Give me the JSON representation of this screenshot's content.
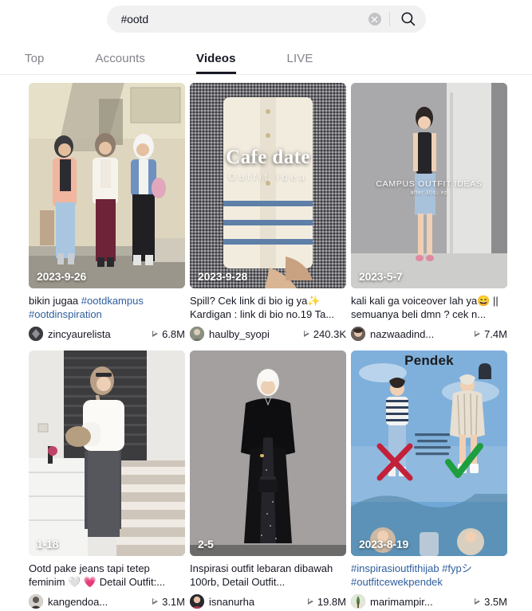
{
  "search": {
    "value": "#ootd",
    "placeholder": "Search",
    "clear_icon": "close-circle-icon",
    "search_icon": "search-icon"
  },
  "tabs": [
    {
      "label": "Top",
      "active": false
    },
    {
      "label": "Accounts",
      "active": false
    },
    {
      "label": "Videos",
      "active": true
    },
    {
      "label": "LIVE",
      "active": false
    }
  ],
  "colors": {
    "text": "#161823",
    "muted": "#82838c",
    "link": "#2f5e9e",
    "field_bg": "#f1f1f2"
  },
  "videos": [
    {
      "date": "2023-9-26",
      "caption_parts": [
        {
          "text": "bikin jugaa ",
          "tag": false
        },
        {
          "text": "#ootdkampus",
          "tag": true
        },
        {
          "text": " ",
          "tag": false
        },
        {
          "text": "#ootdinspiration",
          "tag": true
        }
      ],
      "caption_plain": "bikin jugaa #ootdkampus #ootdinspiration",
      "author": "zincyaurelista",
      "likes": "6.8M",
      "overlay": "",
      "overlay_sub": "",
      "scene": "campus-group"
    },
    {
      "date": "2023-9-28",
      "caption_parts": [
        {
          "text": "Spill? Cek link di bio ig ya✨ Kardigan : link di bio no.19 Ta...",
          "tag": false
        }
      ],
      "caption_plain": "Spill? Cek link di bio ig ya✨ Kardigan : link di bio no.19 Ta...",
      "author": "haulby_syopi",
      "likes": "240.3K",
      "overlay": "Cafe date",
      "overlay_sub": "Outfit Idea",
      "scene": "cardigan-flatlay"
    },
    {
      "date": "2023-5-7",
      "caption_parts": [
        {
          "text": "kali kali ga voiceover lah ya😄 || semuanya beli dmn ? cek n...",
          "tag": false
        }
      ],
      "caption_plain": "kali kali ga voiceover lah ya😄 || semuanya beli dmn ? cek n...",
      "author": "nazwaadind...",
      "likes": "7.4M",
      "overlay": "CAMPUS OUTFIT IDEAS",
      "overlay_sub": "after 30s↓ ep",
      "scene": "denim-girl"
    },
    {
      "date": "1-18",
      "caption_parts": [
        {
          "text": "Ootd pake jeans tapi tetep feminim 🤍 💗 Detail Outfit:...",
          "tag": false
        }
      ],
      "caption_plain": "Ootd pake jeans tapi tetep feminim 🤍 💗 Detail Outfit:...",
      "author": "kangendoa...",
      "likes": "3.1M",
      "overlay": "",
      "overlay_sub": "",
      "scene": "white-blouse-room"
    },
    {
      "date": "2-5",
      "caption_parts": [
        {
          "text": "Inspirasi outfit lebaran dibawah 100rb, Detail Outfit...",
          "tag": false
        }
      ],
      "caption_plain": "Inspirasi outfit lebaran dibawah 100rb, Detail Outfit...",
      "author": "isnanurha",
      "likes": "19.8M",
      "overlay": "",
      "overlay_sub": "",
      "scene": "black-dress"
    },
    {
      "date": "2023-8-19",
      "caption_parts": [
        {
          "text": "#inspirasioutfithijab #fypシ",
          "tag": true
        },
        {
          "text": " ",
          "tag": false
        },
        {
          "text": "#outfitcewekpendek",
          "tag": true
        }
      ],
      "caption_plain": "#inspirasioutfithijab #fypシ #outfitcewekpendek",
      "author": "marimampir...",
      "likes": "3.5M",
      "overlay": "Pendek",
      "overlay_sub": "",
      "scene": "collage-tips"
    }
  ]
}
